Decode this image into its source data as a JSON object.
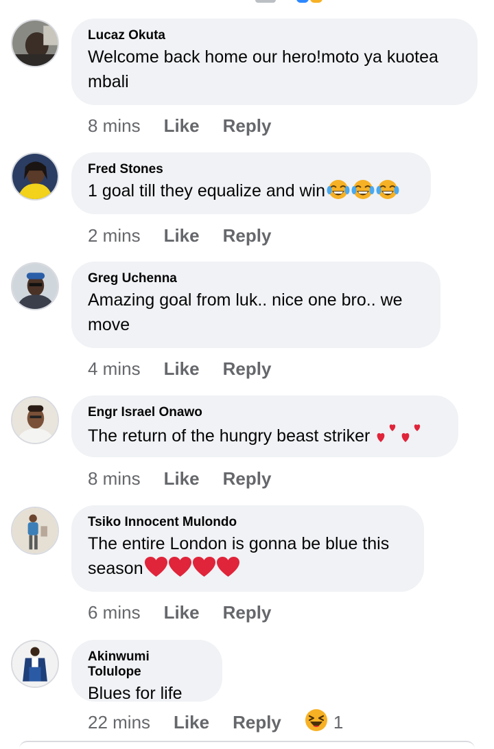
{
  "colors": {
    "bubble": "#f0f2f5",
    "meta_text": "#65676b",
    "primary_text": "#050505",
    "heart": "#e0243a",
    "laugh": "#f7b125"
  },
  "comments": [
    {
      "author": "Lucaz Okuta",
      "text": "Welcome back home our hero!moto ya kuotea mbali",
      "emojis": [],
      "time": "8 mins",
      "like": "Like",
      "reply": "Reply"
    },
    {
      "author": "Fred Stones",
      "text": "1 goal till they equalize and win",
      "emojis": [
        "tears-of-joy-icon",
        "tears-of-joy-icon",
        "tears-of-joy-icon"
      ],
      "time": "2 mins",
      "like": "Like",
      "reply": "Reply"
    },
    {
      "author": "Greg Uchenna",
      "text": "Amazing goal from luk.. nice one bro.. we move",
      "emojis": [],
      "time": "4 mins",
      "like": "Like",
      "reply": "Reply"
    },
    {
      "author": "Engr Israel Onawo",
      "text": "The return of the hungry beast striker ",
      "emojis": [
        "two-hearts-icon",
        "two-hearts-icon"
      ],
      "time": "8 mins",
      "like": "Like",
      "reply": "Reply"
    },
    {
      "author": "Tsiko Innocent Mulondo",
      "text": "The entire London is gonna be blue this season",
      "emojis": [
        "red-heart-icon",
        "red-heart-icon",
        "red-heart-icon",
        "red-heart-icon"
      ],
      "time": "6 mins",
      "like": "Like",
      "reply": "Reply"
    },
    {
      "author": "Akinwumi Tolulope",
      "text": "Blues for life",
      "emojis": [],
      "time": "22 mins",
      "like": "Like",
      "reply": "Reply",
      "reaction": {
        "icon": "haha-reaction-icon",
        "count": "1"
      }
    }
  ]
}
